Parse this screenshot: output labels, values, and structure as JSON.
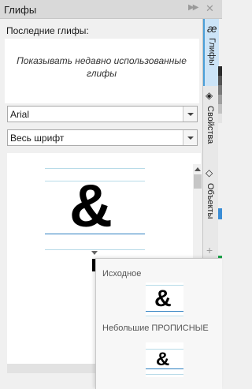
{
  "panel": {
    "title": "Глифы",
    "recent_label": "Последние глифы:",
    "recent_hint": "Показывать недавно использованные глифы",
    "font_name": "Arial",
    "glyph_range": "Весь шрифт",
    "selected_glyph": "&"
  },
  "dock": {
    "tabs": [
      {
        "label": "Глифы",
        "icon": "glyphs-icon",
        "glyph": "æ"
      },
      {
        "label": "Свойства",
        "icon": "properties-icon",
        "glyph": "◈"
      },
      {
        "label": "Объекты",
        "icon": "layers-icon",
        "glyph": "◇"
      }
    ],
    "add_label": "+"
  },
  "popup": {
    "original_label": "Исходное",
    "original_glyph": "&",
    "small_caps_label": "Небольшие ПРОПИСНЫЕ",
    "small_caps_glyph": "&"
  },
  "colors": {
    "accent": "#4a9fd8",
    "guide_line": "#b8dbe8",
    "baseline": "#2d7fc1"
  },
  "swatches": [
    "#2b2b2b",
    "#555555",
    "#7a7a7a",
    "#a0a0a0",
    "#c2c2c2",
    "#e4e4e4",
    "#3a8dd6",
    "#1da34a",
    "#f0d010",
    "#e03030"
  ]
}
